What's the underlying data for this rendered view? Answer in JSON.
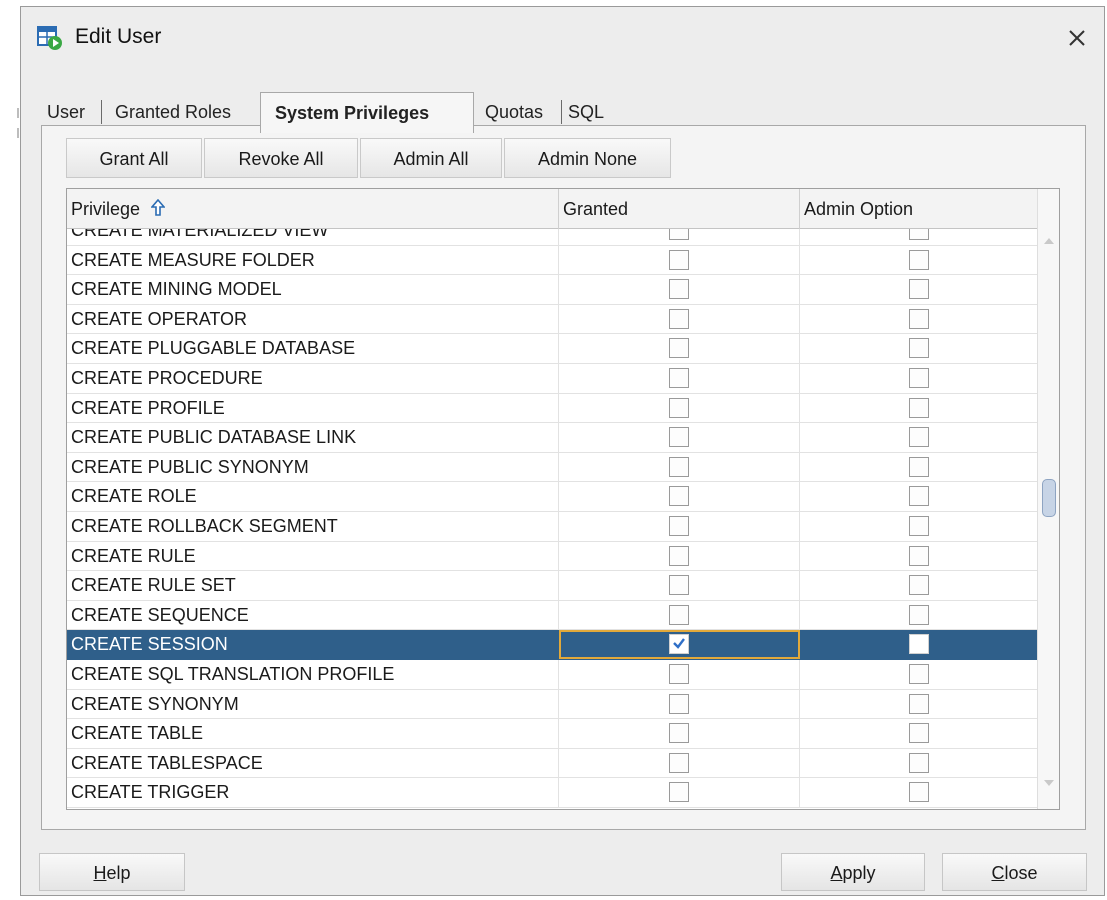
{
  "window": {
    "title": "Edit User",
    "icon": "edit-user-icon"
  },
  "tabs": [
    {
      "label": "User"
    },
    {
      "label": "Granted Roles"
    },
    {
      "label": "System Privileges",
      "active": true
    },
    {
      "label": "Quotas"
    },
    {
      "label": "SQL"
    }
  ],
  "toolbar": {
    "grant_all": "Grant All",
    "revoke_all": "Revoke All",
    "admin_all": "Admin All",
    "admin_none": "Admin None"
  },
  "table": {
    "columns": [
      "Privilege",
      "Granted",
      "Admin Option"
    ],
    "sort_icon": "sort-ascending-icon",
    "rows": [
      {
        "privilege": "CREATE MATERIALIZED VIEW",
        "granted": false,
        "admin": false
      },
      {
        "privilege": "CREATE MEASURE FOLDER",
        "granted": false,
        "admin": false
      },
      {
        "privilege": "CREATE MINING MODEL",
        "granted": false,
        "admin": false
      },
      {
        "privilege": "CREATE OPERATOR",
        "granted": false,
        "admin": false
      },
      {
        "privilege": "CREATE PLUGGABLE DATABASE",
        "granted": false,
        "admin": false
      },
      {
        "privilege": "CREATE PROCEDURE",
        "granted": false,
        "admin": false
      },
      {
        "privilege": "CREATE PROFILE",
        "granted": false,
        "admin": false
      },
      {
        "privilege": "CREATE PUBLIC DATABASE LINK",
        "granted": false,
        "admin": false
      },
      {
        "privilege": "CREATE PUBLIC SYNONYM",
        "granted": false,
        "admin": false
      },
      {
        "privilege": "CREATE ROLE",
        "granted": false,
        "admin": false
      },
      {
        "privilege": "CREATE ROLLBACK SEGMENT",
        "granted": false,
        "admin": false
      },
      {
        "privilege": "CREATE RULE",
        "granted": false,
        "admin": false
      },
      {
        "privilege": "CREATE RULE SET",
        "granted": false,
        "admin": false
      },
      {
        "privilege": "CREATE SEQUENCE",
        "granted": false,
        "admin": false
      },
      {
        "privilege": "CREATE SESSION",
        "granted": true,
        "admin": false,
        "selected": true
      },
      {
        "privilege": "CREATE SQL TRANSLATION PROFILE",
        "granted": false,
        "admin": false
      },
      {
        "privilege": "CREATE SYNONYM",
        "granted": false,
        "admin": false
      },
      {
        "privilege": "CREATE TABLE",
        "granted": false,
        "admin": false
      },
      {
        "privilege": "CREATE TABLESPACE",
        "granted": false,
        "admin": false
      },
      {
        "privilege": "CREATE TRIGGER",
        "granted": false,
        "admin": false
      }
    ]
  },
  "footer": {
    "help": {
      "mnemonic": "H",
      "rest": "elp"
    },
    "apply": {
      "mnemonic": "A",
      "rest": "pply"
    },
    "close": {
      "mnemonic": "C",
      "rest": "lose"
    }
  },
  "colors": {
    "selection": "#2f5f8a",
    "focus_border": "#e2a93a",
    "check": "#2f6fc7"
  }
}
